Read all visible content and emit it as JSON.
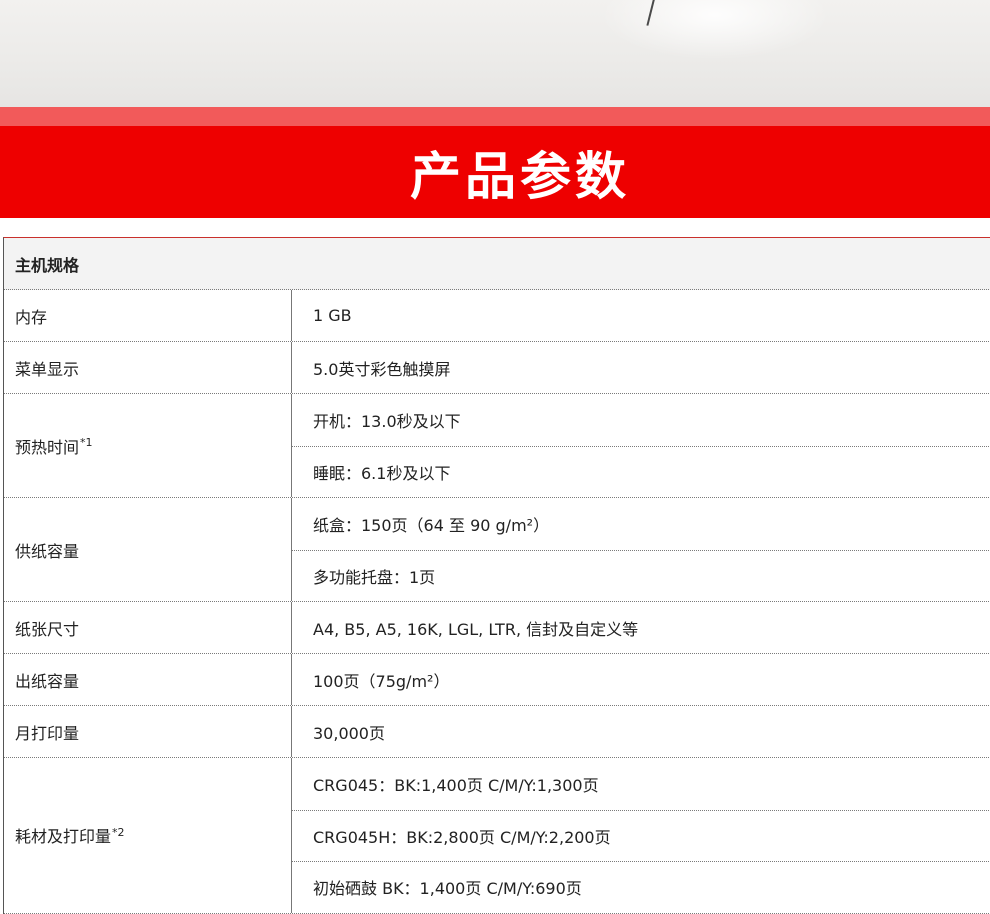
{
  "banner": {
    "title": "产品参数"
  },
  "spec": {
    "section_header": "主机规格",
    "rows": [
      {
        "label": "内存",
        "values": [
          "1 GB"
        ]
      },
      {
        "label": "菜单显示",
        "values": [
          "5.0英寸彩色触摸屏"
        ]
      },
      {
        "label": "预热时间",
        "sup": "*1",
        "values": [
          "开机：13.0秒及以下",
          "睡眠：6.1秒及以下"
        ]
      },
      {
        "label": "供纸容量",
        "values": [
          "纸盒：150页（64 至 90 g/m²）",
          "多功能托盘：1页"
        ]
      },
      {
        "label": "纸张尺寸",
        "values": [
          "A4, B5, A5, 16K, LGL, LTR, 信封及自定义等"
        ]
      },
      {
        "label": "出纸容量",
        "values": [
          "100页（75g/m²）"
        ]
      },
      {
        "label": "月打印量",
        "values": [
          "30,000页"
        ]
      },
      {
        "label": "耗材及打印量",
        "sup": "*2",
        "values": [
          "CRG045：BK:1,400页 C/M/Y:1,300页",
          "CRG045H：BK:2,800页 C/M/Y:2,200页",
          "初始硒鼓 BK：1,400页 C/M/Y:690页"
        ]
      }
    ]
  }
}
